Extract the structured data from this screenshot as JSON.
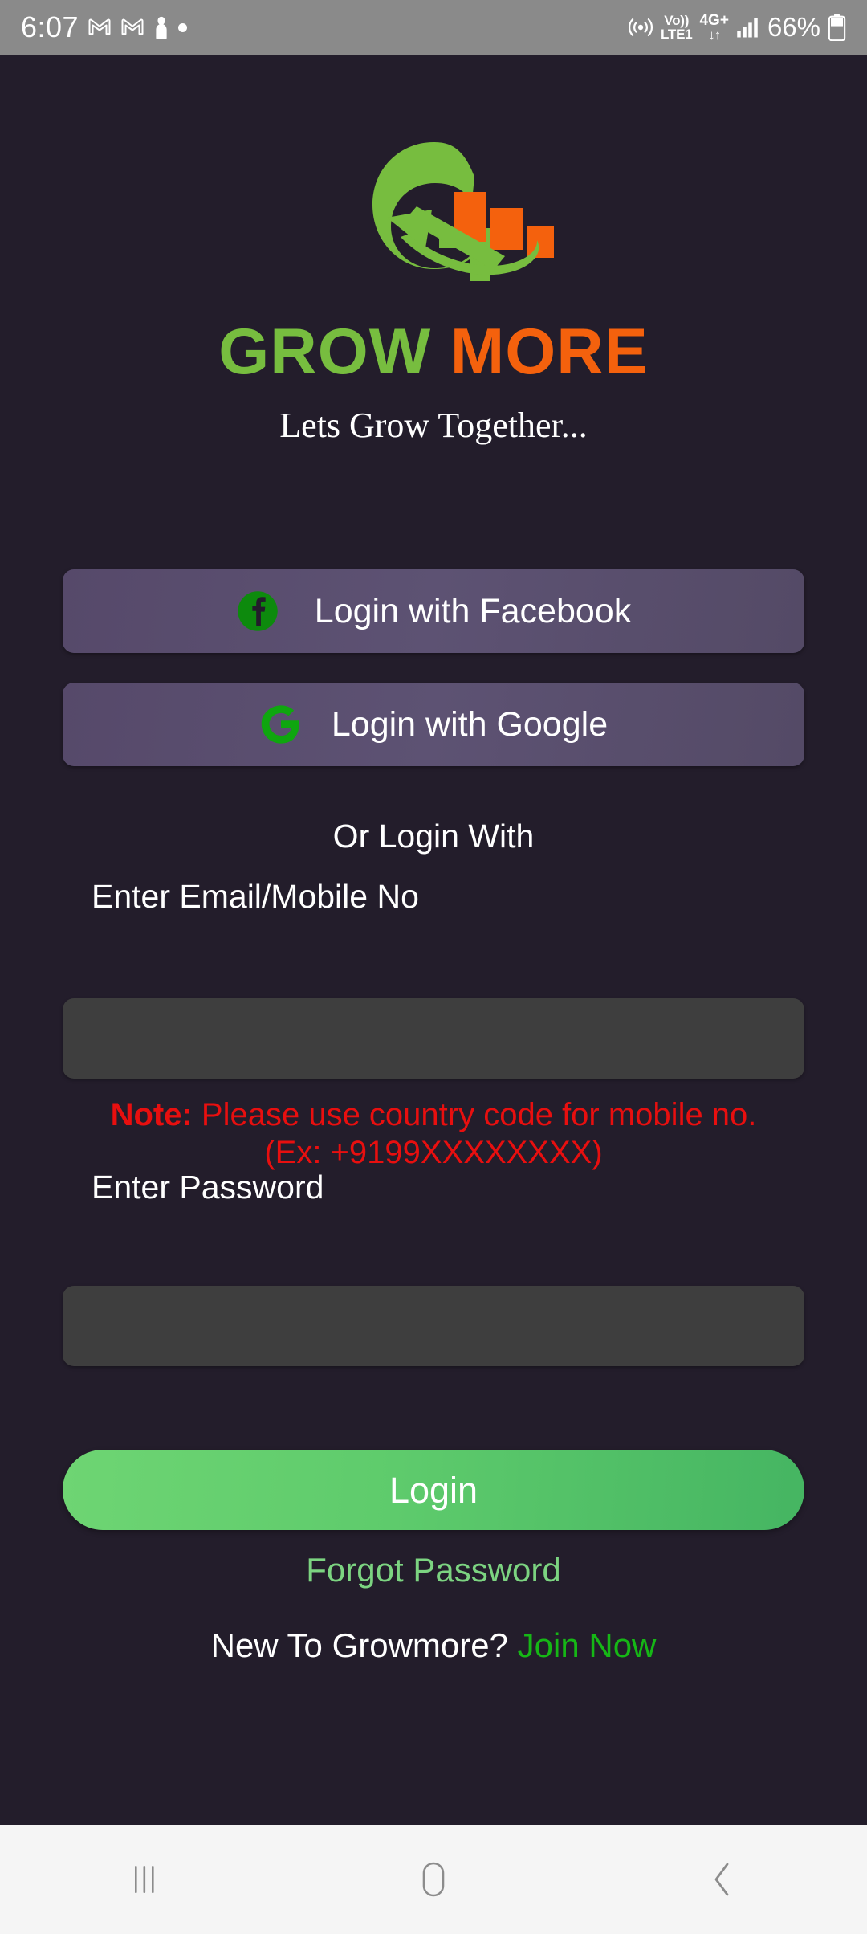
{
  "status_bar": {
    "time": "6:07",
    "icons_left": [
      "gmail-icon",
      "gmail-icon",
      "person-icon",
      "dot-indicator"
    ],
    "volte_top": "Vo))",
    "volte_bottom": "LTE1",
    "network": "4G+",
    "data_arrows": "↓↑",
    "battery_percent": "66%",
    "icons_right": [
      "hotspot-icon",
      "volte-icon",
      "network-4g-icon",
      "signal-icon",
      "battery-icon"
    ]
  },
  "brand": {
    "name_part1": "GROW",
    "name_part2": "MORE",
    "tagline": "Lets Grow Together...",
    "green": "#77bd3f",
    "orange": "#f4610d"
  },
  "social_login": {
    "facebook_label": "Login with Facebook",
    "google_label": "Login with Google",
    "facebook_icon": "facebook-icon",
    "google_icon": "google-icon"
  },
  "divider": {
    "text": "Or Login With"
  },
  "form": {
    "email_label": "Enter Email/Mobile No",
    "email_value": "",
    "email_placeholder": "",
    "note_prefix": "Note:",
    "note_line1": " Please use country code for mobile no.",
    "note_line2": "(Ex: +9199XXXXXXXX)",
    "note_color": "#e80f0f",
    "password_label": "Enter Password",
    "password_value": "",
    "password_placeholder": ""
  },
  "actions": {
    "login_label": "Login",
    "login_gradient_from": "#6ed573",
    "login_gradient_to": "#45b562",
    "forgot_password_label": "Forgot Password",
    "forgot_color": "#7cd481",
    "signup_prompt": "New To Growmore?",
    "signup_link": "Join Now",
    "signup_link_color": "#16b716"
  },
  "navigation_bar": {
    "recent_icon": "recent-apps-icon",
    "home_icon": "home-icon",
    "back_icon": "back-icon"
  }
}
